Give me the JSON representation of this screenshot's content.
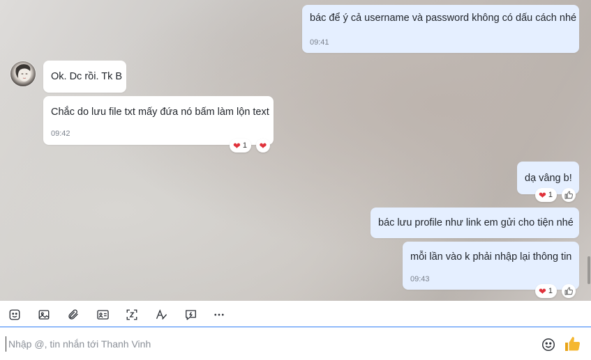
{
  "messages": [
    {
      "id": "m1",
      "dir": "out",
      "text": "bác để ý cả username và password không có dấu cách nhé",
      "time": "09:41"
    },
    {
      "id": "m2",
      "dir": "in",
      "text": "Ok. Dc rồi. Tk B"
    },
    {
      "id": "m3",
      "dir": "in",
      "text": "Chắc do lưu file txt mấy đứa nó bấm làm lộn text",
      "time": "09:42",
      "reaction_count": "1"
    },
    {
      "id": "m4",
      "dir": "out",
      "text": "dạ vâng b!",
      "reaction_count": "1"
    },
    {
      "id": "m5",
      "dir": "out",
      "text": "bác lưu profile như link em gửi cho tiện nhé"
    },
    {
      "id": "m6",
      "dir": "out",
      "text": "mỗi lần vào k phải nhập lại thông tin",
      "time": "09:43",
      "reaction_count": "1"
    }
  ],
  "toolbar": {
    "items": [
      "sticker-icon",
      "image-icon",
      "attachment-icon",
      "contact-card-icon",
      "screenshot-icon",
      "text-format-icon",
      "quick-message-icon",
      "more-icon"
    ]
  },
  "composer": {
    "placeholder": "Nhập @, tin nhắn tới Thanh Vinh"
  },
  "colors": {
    "outgoing_bubble": "#e5efff",
    "incoming_bubble": "#ffffff",
    "accent": "#2f7cf6",
    "heart": "#e0323b",
    "like": "#f5b731"
  }
}
